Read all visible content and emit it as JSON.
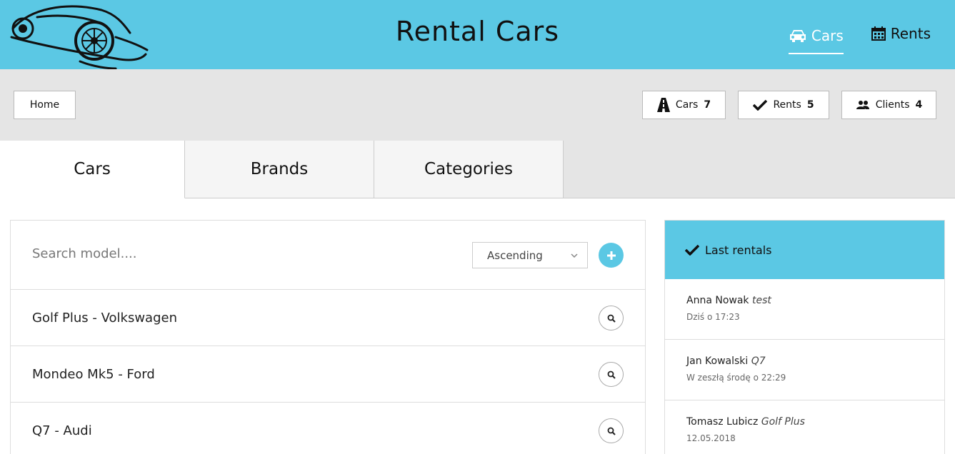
{
  "header": {
    "title": "Rental Cars",
    "nav": [
      {
        "label": "Cars",
        "icon": "car-icon",
        "active": true
      },
      {
        "label": "Rents",
        "icon": "calendar-icon",
        "active": false
      }
    ]
  },
  "toolbar": {
    "home_label": "Home",
    "cars": {
      "label": "Cars",
      "count": "7",
      "icon": "road-icon"
    },
    "rents": {
      "label": "Rents",
      "count": "5",
      "icon": "check-icon"
    },
    "clients": {
      "label": "Clients",
      "count": "4",
      "icon": "users-icon"
    }
  },
  "tabs": [
    {
      "label": "Cars",
      "active": true
    },
    {
      "label": "Brands",
      "active": false
    },
    {
      "label": "Categories",
      "active": false
    }
  ],
  "list": {
    "search_placeholder": "Search model....",
    "sort_selected": "Ascending",
    "items": [
      {
        "label": "Golf Plus - Volkswagen"
      },
      {
        "label": "Mondeo Mk5 - Ford"
      },
      {
        "label": "Q7 - Audi"
      }
    ]
  },
  "side": {
    "title": "Last rentals",
    "rentals": [
      {
        "name": "Anna Nowak",
        "model": "test",
        "time": "Dziś o 17:23"
      },
      {
        "name": "Jan Kowalski",
        "model": "Q7",
        "time": "W zeszłą środę o 22:29"
      },
      {
        "name": "Tomasz Lubicz",
        "model": "Golf Plus",
        "time": "12.05.2018"
      }
    ]
  },
  "colors": {
    "accent": "#5bc8e4",
    "bar": "#e5e5e5"
  }
}
